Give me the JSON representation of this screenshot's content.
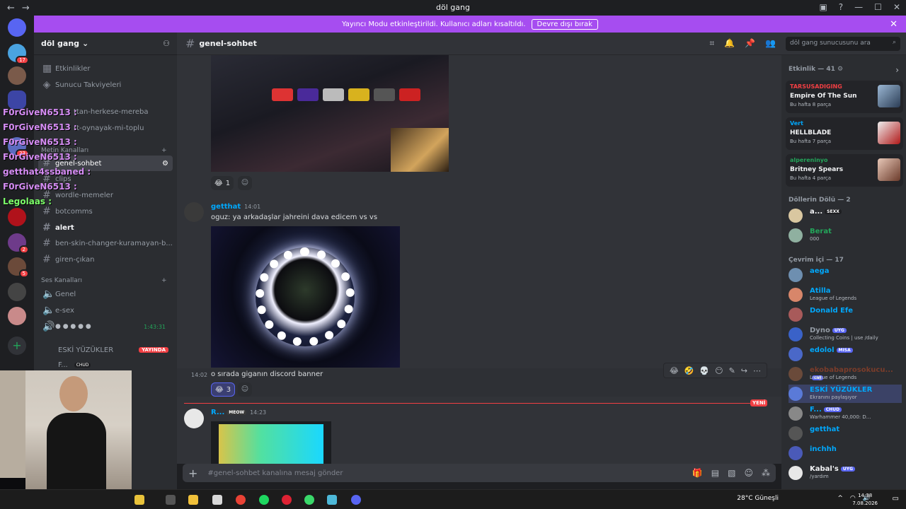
{
  "window": {
    "title": "döl gang",
    "brand_color": "#5865f2"
  },
  "banner": {
    "text": "Yayıncı Modu etkinleştirildi. Kullanıcı adları kısaltıldı.",
    "button": "Devre dışı bırak"
  },
  "servers": {
    "badges": [
      "17",
      "23",
      "2",
      "5"
    ]
  },
  "guild": {
    "name": "döl gang"
  },
  "channels": {
    "top_items": [
      "Etkinlikler",
      "Sunucu Takviyeleri"
    ],
    "partial_items": [
      "ttan-herkese-mereba",
      "rt-oynayak-mi-toplu"
    ],
    "text_category": "Metin Kanalları",
    "text": [
      "genel-sohbet",
      "clips",
      "wordle-memeler",
      "botcomms",
      "alert",
      "ben-skin-changer-kuramayan-b...",
      "giren-çıkan"
    ],
    "voice_category": "Ses Kanalları",
    "voice": [
      "Genel",
      "e-sex"
    ],
    "voice_timer": "1:43:31",
    "voice_users": [
      {
        "name": "ESKİ YÜZÜKLER",
        "badge": "YAYINDA"
      },
      {
        "name": "F...",
        "badge": "CHUD"
      }
    ]
  },
  "overlay_chat": [
    {
      "name": "F0rGiveN6513 :"
    },
    {
      "name": "F0rGiveN6513 :"
    },
    {
      "name": "F0rGiveN6513 :"
    },
    {
      "name": "F0rGiveN6513 :"
    },
    {
      "name": "getthat4ssbaned :"
    },
    {
      "name": "F0rGiveN6513 :"
    },
    {
      "name": "Legolaas :"
    }
  ],
  "header": {
    "channel": "genel-sohbet",
    "search_placeholder": "döl gang sunucusunu ara"
  },
  "messages": {
    "first_reaction": {
      "emoji": "😂",
      "count": "1"
    },
    "msg2": {
      "author": "getthat",
      "time": "14:01",
      "text": "oguz: ya arkadaşlar jahreini dava edicem vs vs"
    },
    "msg3": {
      "time": "14:02",
      "text": "o sırada giganın discord banner",
      "reaction_emoji": "😂",
      "reaction_count": "3"
    },
    "new_label": "YENİ",
    "msg4": {
      "author": "R...",
      "badge": "MEOW",
      "time": "14:23"
    }
  },
  "toolbar": {
    "icons": [
      "😂",
      "🤣",
      "💀",
      "😶",
      "✎",
      "↪",
      "⋯"
    ]
  },
  "composer": {
    "placeholder": "#genel-sohbet kanalına mesaj gönder"
  },
  "members": {
    "activity_header": "Etkinlik — 41",
    "activities": [
      {
        "user": "TARSUSADIGING",
        "title": "Empire Of The Sun",
        "sub": "Bu hafta 8 parça",
        "color": "#f23f43"
      },
      {
        "user": "Vert",
        "title": "HELLBLADE",
        "sub": "Bu hafta 7 parça",
        "color": "#00a8fc"
      },
      {
        "user": "alpereninyo",
        "title": "Britney Spears",
        "sub": "Bu hafta 4 parça",
        "color": "#23a55a"
      }
    ],
    "role_header": "Döllerin Dölü — 2",
    "role_members": [
      {
        "name": "a...",
        "badge": "SEXX",
        "sub": "",
        "color": "#f2f3f5"
      },
      {
        "name": "Berat",
        "badge": "",
        "sub": "000",
        "color": "#23a55a"
      }
    ],
    "online_header": "Çevrim içi — 17",
    "online": [
      {
        "name": "aega",
        "sub": "",
        "color": "#00a8fc"
      },
      {
        "name": "Atilla",
        "sub": "League of Legends",
        "color": "#00a8fc"
      },
      {
        "name": "Donald Efe",
        "sub": "",
        "color": "#00a8fc"
      },
      {
        "name": "Dyno",
        "sub": "Collecting Coins | use /daily",
        "color": "#949ba4",
        "badge": "UYG"
      },
      {
        "name": "edolol",
        "sub": "",
        "color": "#00a8fc",
        "badge": "MISA"
      },
      {
        "name": "ekobabaprosokucu...",
        "sub": "League of Legends",
        "color": "#7a3c2a",
        "badge": "cat"
      },
      {
        "name": "ESKİ YÜZÜKLER",
        "sub": "Ekranını paylaşıyor",
        "color": "#00a8fc"
      },
      {
        "name": "F...",
        "sub": "Warhammer 40,000: D...",
        "color": "#00a8fc",
        "badge": "CHUD"
      },
      {
        "name": "getthat",
        "sub": "",
        "color": "#00a8fc"
      },
      {
        "name": "inchhh",
        "sub": "",
        "color": "#00a8fc"
      },
      {
        "name": "Kabal's",
        "sub": "/yardım",
        "color": "#f2f3f5",
        "badge": "UYG"
      }
    ]
  },
  "taskbar": {
    "weather": "28°C Güneşli",
    "time": "14:38",
    "date": "7.08.2026"
  }
}
